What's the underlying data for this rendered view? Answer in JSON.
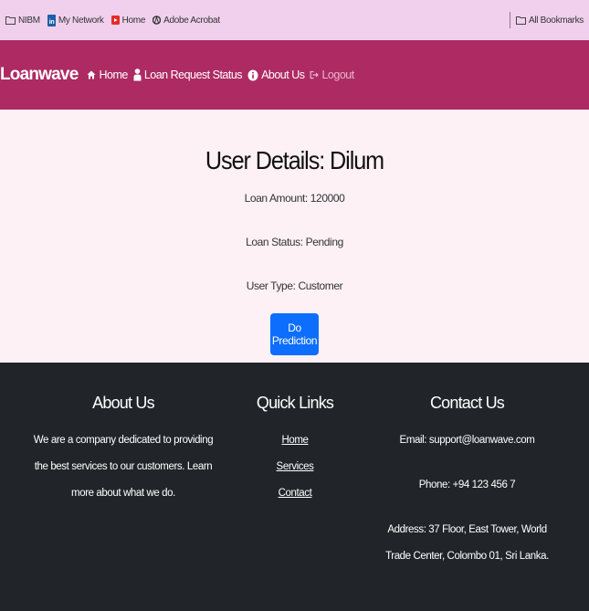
{
  "bookmarks": {
    "items": [
      {
        "label": "NIBM",
        "icon": "folder-icon"
      },
      {
        "label": "My Network",
        "icon": "linkedin-icon"
      },
      {
        "label": "Home",
        "icon": "youtube-icon"
      },
      {
        "label": "Adobe Acrobat",
        "icon": "acrobat-icon"
      }
    ],
    "all_bookmarks": "All Bookmarks"
  },
  "navbar": {
    "brand": "Loanwave",
    "links": [
      {
        "label": "Home",
        "icon": "home-icon"
      },
      {
        "label": "Loan Request Status",
        "icon": "user-icon"
      },
      {
        "label": "About Us",
        "icon": "info-icon"
      },
      {
        "label": "Logout",
        "icon": "logout-icon"
      }
    ],
    "background": "#ad2a63"
  },
  "main": {
    "title": "User Details: Dilum",
    "loan_amount": "Loan Amount: 120000",
    "loan_status": "Loan Status: Pending",
    "user_type": "User Type: Customer",
    "predict_button": "Do Prediction"
  },
  "footer": {
    "about": {
      "heading": "About Us",
      "text": "We are a company dedicated to providing the best services to our customers. Learn more about what we do."
    },
    "quick_links": {
      "heading": "Quick Links",
      "links": [
        "Home",
        "Services",
        "Contact"
      ]
    },
    "contact": {
      "heading": "Contact Us",
      "email": "Email: support@loanwave.com",
      "phone": "Phone: +94 123 456 7",
      "address": "Address: 37 Floor, East Tower, World Trade Center, Colombo 01, Sri Lanka."
    }
  },
  "colors": {
    "bookmarks_bar": "#f0d0ec",
    "navbar": "#ad2a63",
    "main_bg": "#fdf1f6",
    "button": "#0d6efd",
    "footer": "#212529"
  }
}
